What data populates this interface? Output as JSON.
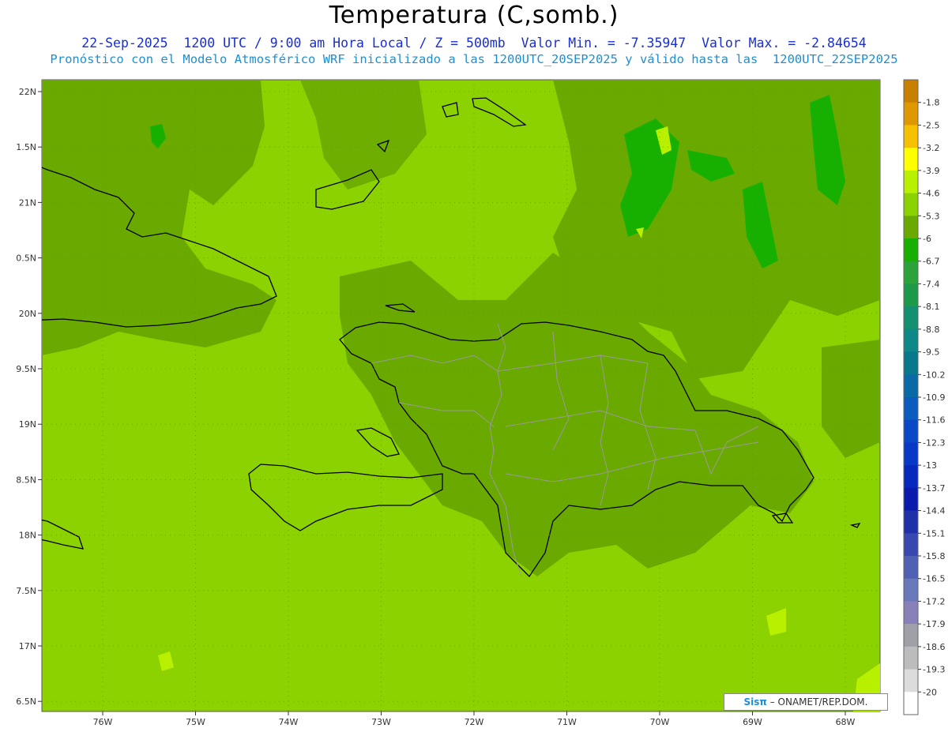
{
  "title": "Temperatura (C,somb.)",
  "subtitle_line1": "22-Sep-2025  1200 UTC / 9:00 am Hora Local / Z = 500mb  Valor Min. = -7.35947  Valor Max. = -2.84654",
  "subtitle_line2": "Pronóstico con el Modelo Atmosférico WRF inicializado a las 1200UTC_20SEP2025 y válido hasta las  1200UTC_22SEP2025",
  "lat_labels": [
    "22N",
    "1.5N",
    "21N",
    "0.5N",
    "20N",
    "9.5N",
    "19N",
    "8.5N",
    "18N",
    "7.5N",
    "17N",
    "6.5N"
  ],
  "lon_labels": [
    "76W",
    "75W",
    "74W",
    "73W",
    "72W",
    "71W",
    "70W",
    "69W",
    "68W"
  ],
  "colorbar": {
    "labels": [
      "-1.8",
      "-2.5",
      "-3.2",
      "-3.9",
      "-4.6",
      "-5.3",
      "-6",
      "-6.7",
      "-7.4",
      "-8.1",
      "-8.8",
      "-9.5",
      "-10.2",
      "-10.9",
      "-11.6",
      "-12.3",
      "-13",
      "-13.7",
      "-14.4",
      "-15.1",
      "-15.8",
      "-16.5",
      "-17.2",
      "-17.9",
      "-18.6",
      "-19.3",
      "-20"
    ],
    "colors": [
      "#c88000",
      "#e09800",
      "#f5c000",
      "#ffff00",
      "#b8f000",
      "#8cd200",
      "#6aaa00",
      "#18b000",
      "#2aa43a",
      "#1c9a4a",
      "#129070",
      "#0c8888",
      "#08788c",
      "#0a6aa6",
      "#0c5cc0",
      "#0a48c8",
      "#0838c8",
      "#0628bc",
      "#0a1aac",
      "#2030a8",
      "#3848b0",
      "#5060b4",
      "#6878b8",
      "#8880b8",
      "#a0a0a8",
      "#bcbcbc",
      "#dcdcdc",
      "#ffffff"
    ]
  },
  "colors": {
    "land_fill": "#8cd200",
    "cool_fill": "#6aaa00",
    "cold_fill": "#18b000",
    "warm_fill": "#b8f000",
    "coast": "#000000",
    "border": "#9a9a9a"
  },
  "credit": {
    "brand": "Sisπ",
    "text": " – ONAMET/REP.DOM."
  }
}
